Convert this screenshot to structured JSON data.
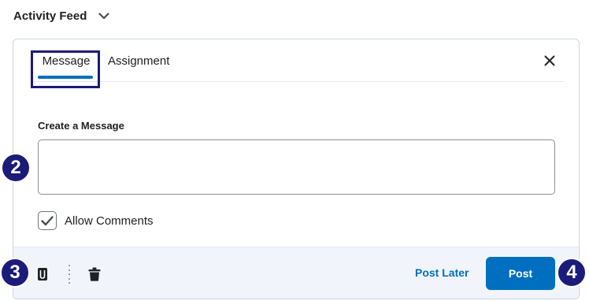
{
  "header": {
    "title": "Activity Feed",
    "toggle_icon": "chevron-down-icon"
  },
  "tabs": [
    {
      "label": "Message",
      "selected": true
    },
    {
      "label": "Assignment",
      "selected": false
    }
  ],
  "close_icon": "close-icon",
  "form": {
    "label": "Create a Message",
    "message_value": "",
    "allow_comments": {
      "label": "Allow Comments",
      "checked": true
    }
  },
  "footer": {
    "attach_icon": "paperclip-icon",
    "more_icon": "vertical-dots-divider",
    "delete_icon": "trash-icon",
    "post_later_label": "Post Later",
    "post_label": "Post"
  },
  "callouts": [
    "2",
    "3",
    "4"
  ],
  "colors": {
    "accent": "#006fbf",
    "callout": "#1b1b7a",
    "footer_bg": "#f1f5fb"
  }
}
